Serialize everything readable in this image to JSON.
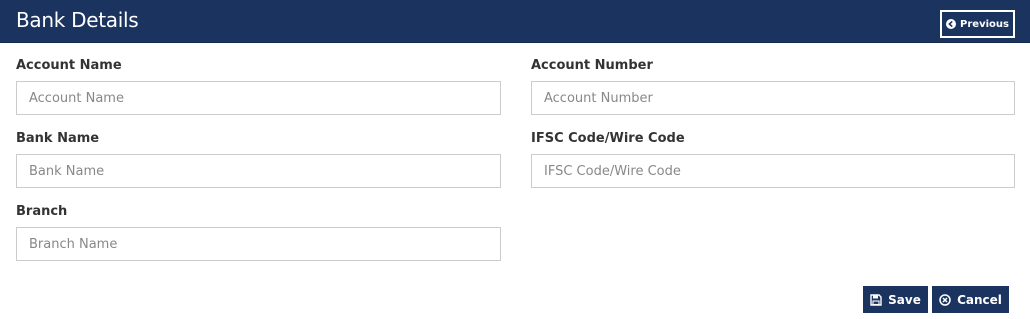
{
  "header": {
    "title": "Bank Details",
    "previous_label": "Previous"
  },
  "form": {
    "account_name": {
      "label": "Account Name",
      "placeholder": "Account Name",
      "value": ""
    },
    "account_number": {
      "label": "Account Number",
      "placeholder": "Account Number",
      "value": ""
    },
    "bank_name": {
      "label": "Bank Name",
      "placeholder": "Bank Name",
      "value": ""
    },
    "ifsc_code": {
      "label": "IFSC Code/Wire Code",
      "placeholder": "IFSC Code/Wire Code",
      "value": ""
    },
    "branch": {
      "label": "Branch",
      "placeholder": "Branch Name",
      "value": ""
    }
  },
  "actions": {
    "save_label": "Save",
    "cancel_label": "Cancel"
  },
  "icons": {
    "previous": "arrow-circle-left-icon",
    "save": "floppy-disk-icon",
    "cancel": "times-circle-icon"
  },
  "colors": {
    "primary": "#1a335f",
    "border": "#cccccc",
    "label_text": "#333333",
    "placeholder_text": "#888888"
  }
}
